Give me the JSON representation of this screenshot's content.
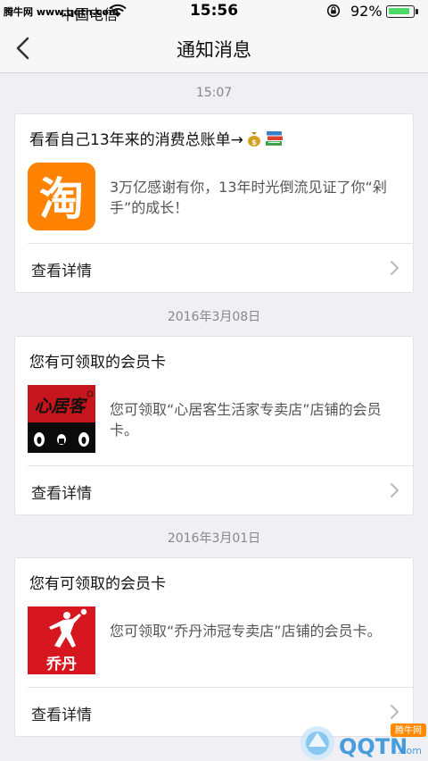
{
  "status_bar": {
    "site": "腾牛网 www.qqtn.com",
    "carrier": "中国电信",
    "time": "15:56",
    "battery": "92%",
    "battery_level": 0.92
  },
  "nav": {
    "title": "通知消息"
  },
  "notifications": [
    {
      "time": "15:07",
      "title": "看看自己13年来的消费总账单→",
      "title_icons": [
        "money-bag-icon",
        "books-icon"
      ],
      "logo": {
        "name": "taobao-logo",
        "text": "淘",
        "color": "#ff8200"
      },
      "message": "3万亿感谢有你，13年时光倒流见证了你“剁手”的成长！",
      "detail_label": "查看详情"
    },
    {
      "time": "2016年3月08日",
      "title": "您有可领取的会员卡",
      "logo": {
        "name": "xinjuke-logo",
        "text": "心居客",
        "color": "#c4161c"
      },
      "message": "您可领取“心居客生活家专卖店”店铺的会员卡。",
      "detail_label": "查看详情"
    },
    {
      "time": "2016年3月01日",
      "title": "您有可领取的会员卡",
      "logo": {
        "name": "qiaodan-logo",
        "text": "乔丹",
        "color": "#d7171f"
      },
      "message": "您可领取“乔丹沛冠专卖店”店铺的会员卡。",
      "detail_label": "查看详情"
    }
  ],
  "watermark": {
    "text": "QQTN",
    "suffix": ".com",
    "badge": "腾牛网"
  }
}
